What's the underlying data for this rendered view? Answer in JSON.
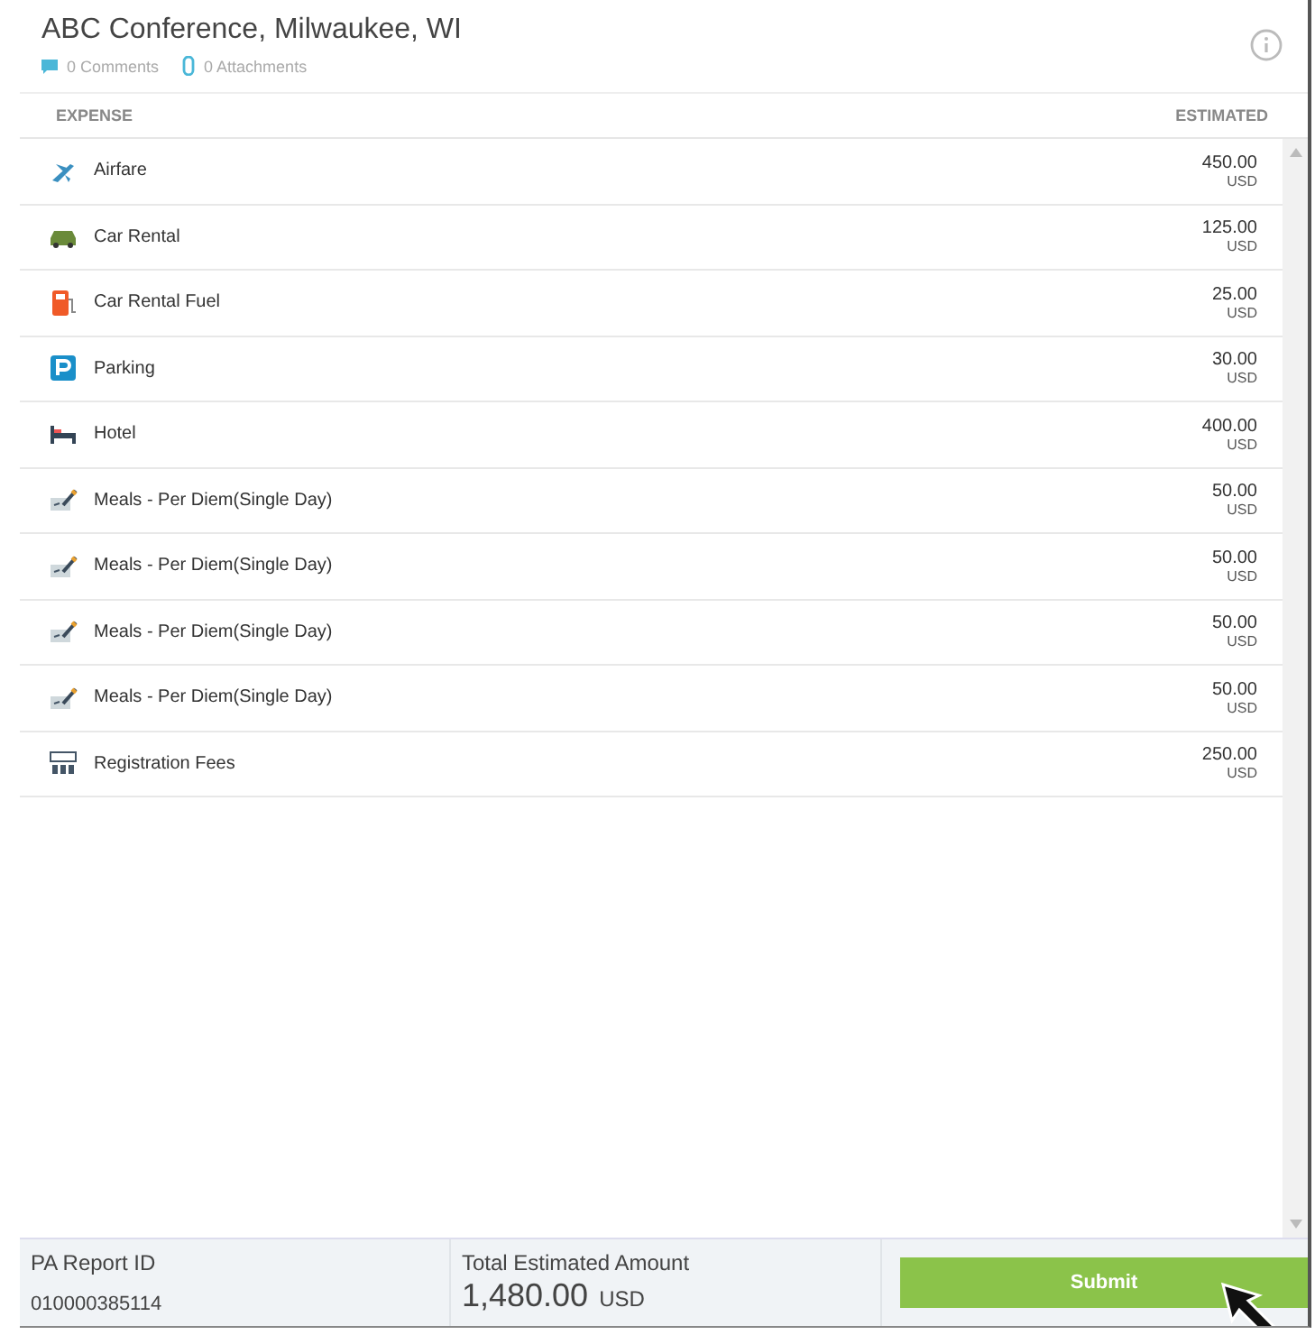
{
  "header": {
    "title": "ABC Conference, Milwaukee, WI",
    "comments": "0 Comments",
    "attachments": "0 Attachments"
  },
  "table": {
    "columns": [
      "EXPENSE",
      "ESTIMATED"
    ],
    "rows": [
      {
        "kind": "airfare",
        "name": "Airfare",
        "amount": "450.00",
        "currency": "USD"
      },
      {
        "kind": "car",
        "name": "Car Rental",
        "amount": "125.00",
        "currency": "USD"
      },
      {
        "kind": "fuel",
        "name": "Car Rental Fuel",
        "amount": "25.00",
        "currency": "USD"
      },
      {
        "kind": "parking",
        "name": "Parking",
        "amount": "30.00",
        "currency": "USD"
      },
      {
        "kind": "hotel",
        "name": "Hotel",
        "amount": "400.00",
        "currency": "USD"
      },
      {
        "kind": "meals",
        "name": "Meals - Per Diem(Single Day)",
        "amount": "50.00",
        "currency": "USD"
      },
      {
        "kind": "meals",
        "name": "Meals - Per Diem(Single Day)",
        "amount": "50.00",
        "currency": "USD"
      },
      {
        "kind": "meals",
        "name": "Meals - Per Diem(Single Day)",
        "amount": "50.00",
        "currency": "USD"
      },
      {
        "kind": "meals",
        "name": "Meals - Per Diem(Single Day)",
        "amount": "50.00",
        "currency": "USD"
      },
      {
        "kind": "registration",
        "name": "Registration Fees",
        "amount": "250.00",
        "currency": "USD"
      }
    ]
  },
  "footer": {
    "report_id_label": "PA Report ID",
    "report_id": "010000385114",
    "total_label": "Total Estimated Amount",
    "total": "1,480.00",
    "total_currency": "USD",
    "submit": "Submit"
  }
}
